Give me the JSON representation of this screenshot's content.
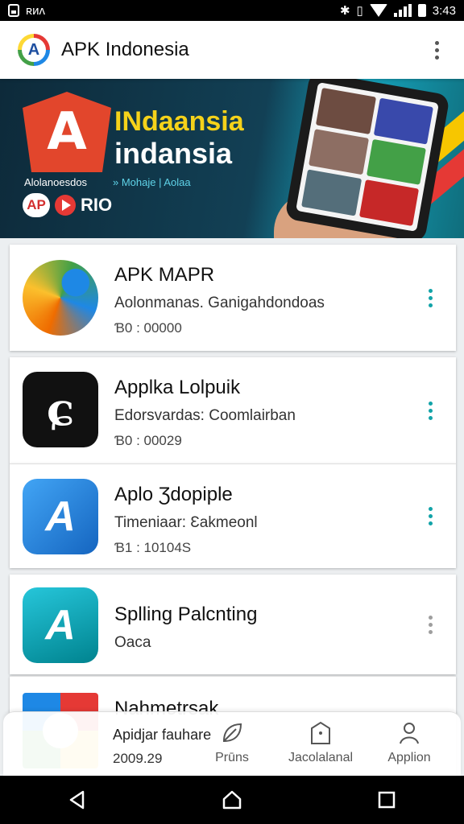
{
  "status_bar": {
    "left_text": "ʀᴎᴧ",
    "time": "3:43"
  },
  "app_bar": {
    "title": "APK Indonesia",
    "logo_letter": "A"
  },
  "banner": {
    "title_line1": "INdaansia",
    "title_line2": "indansia",
    "tagline_left": "Alolanoesdos",
    "tagline_right": "» Mohaje | Aolaa",
    "badge_left": "AP",
    "badge_right": "RIO"
  },
  "apps": [
    {
      "name": "APK MAPR",
      "subtitle": "Aolonmanas. Ganigahdondoas",
      "meta": "Ɓ0 : 00000",
      "icon": "swirl-app-icon"
    },
    {
      "name": "Applka Lolpuik",
      "subtitle": "Edorsvardas: Coomlairban",
      "meta": "Ɓ0 : 00029",
      "icon": "black-app-icon",
      "icon_letter": "ɕ"
    },
    {
      "name": "Aplo Ʒdopiple",
      "subtitle": "Timeniaar: Ɛakmeonl",
      "meta": "Ɓ1 : 10104S",
      "icon": "blue-app-icon",
      "icon_letter": "A"
    },
    {
      "name": "Splling Palcnting",
      "subtitle": "Oaca",
      "meta": "",
      "icon": "teal-app-icon",
      "icon_letter": "A"
    },
    {
      "name": "Nahmetrsak",
      "subtitle": "Apidjar fauhare",
      "meta": "2009.29",
      "icon": "google-app-icon"
    }
  ],
  "bottom_nav": {
    "items": [
      {
        "label": "Prūns",
        "icon": "leaf-icon"
      },
      {
        "label": "Jacolalanal",
        "icon": "bag-icon"
      },
      {
        "label": "Applion",
        "icon": "person-icon"
      }
    ]
  },
  "colors": {
    "accent": "#12a3a8",
    "banner_yellow": "#f5d21a",
    "banner_dark": "#0d2a3a"
  }
}
